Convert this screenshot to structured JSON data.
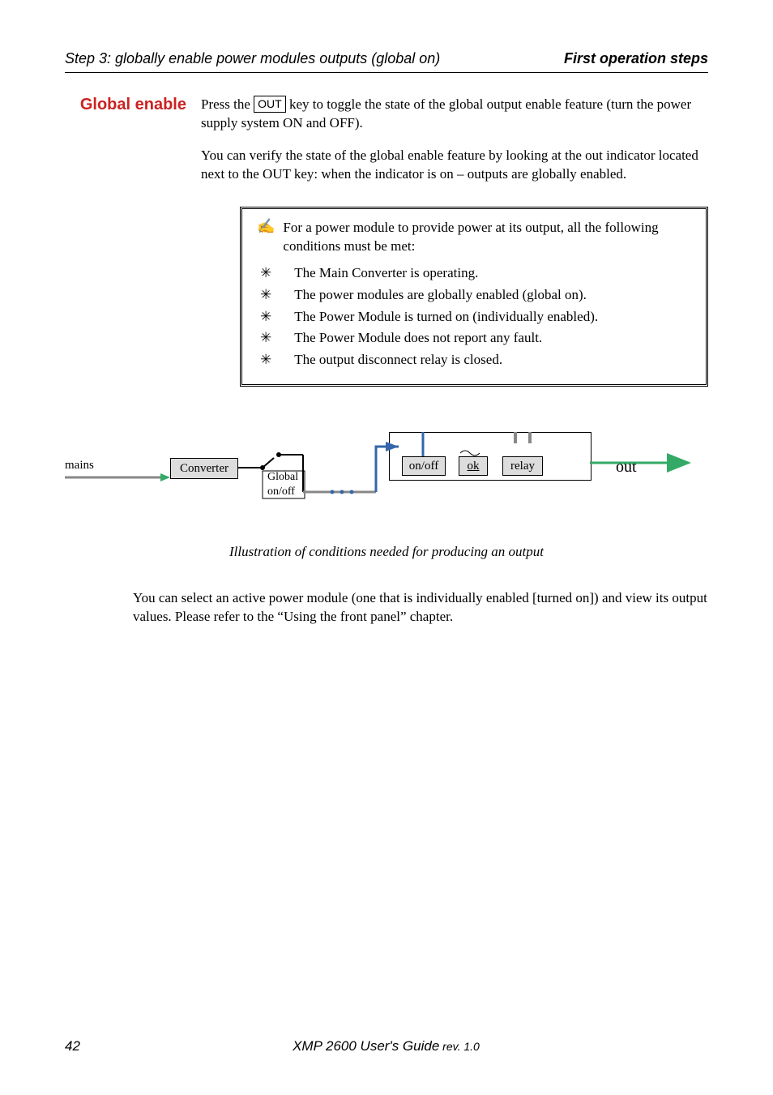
{
  "header": {
    "left": "Step 3: globally enable power modules outputs (global on)",
    "right": "First operation steps"
  },
  "side_heading": "Global enable",
  "para1_a": "Press the ",
  "para1_key": "OUT",
  "para1_b": " key to toggle the state of the global output enable feature (turn the power supply system ON and OFF).",
  "para2": "You can verify the state of the global enable feature by looking at the out indicator located next to the OUT key: when the indicator is on – outputs are globally enabled.",
  "note": {
    "lead": "For a power module to provide power at its output, all the following conditions must be met:",
    "items": [
      "The Main Converter is operating.",
      "The power modules are globally enabled (global on).",
      "The Power Module is turned on (individually enabled).",
      "The Power Module does not report any fault.",
      "The output disconnect relay is closed."
    ]
  },
  "diagram": {
    "mains": "mains",
    "converter": "Converter",
    "global": "Global",
    "onoff_small": "on/off",
    "onoff": "on/off",
    "ok": "ok",
    "relay": "relay",
    "out": "out"
  },
  "caption": "Illustration of conditions needed for producing an output",
  "para3": "You can select an active power module (one that is individually enabled [turned on]) and view its output values. Please refer to the “Using the front panel” chapter.",
  "footer": {
    "page": "42",
    "title_a": "XMP 2600 User's Guide",
    "title_b": " rev. 1.0"
  }
}
